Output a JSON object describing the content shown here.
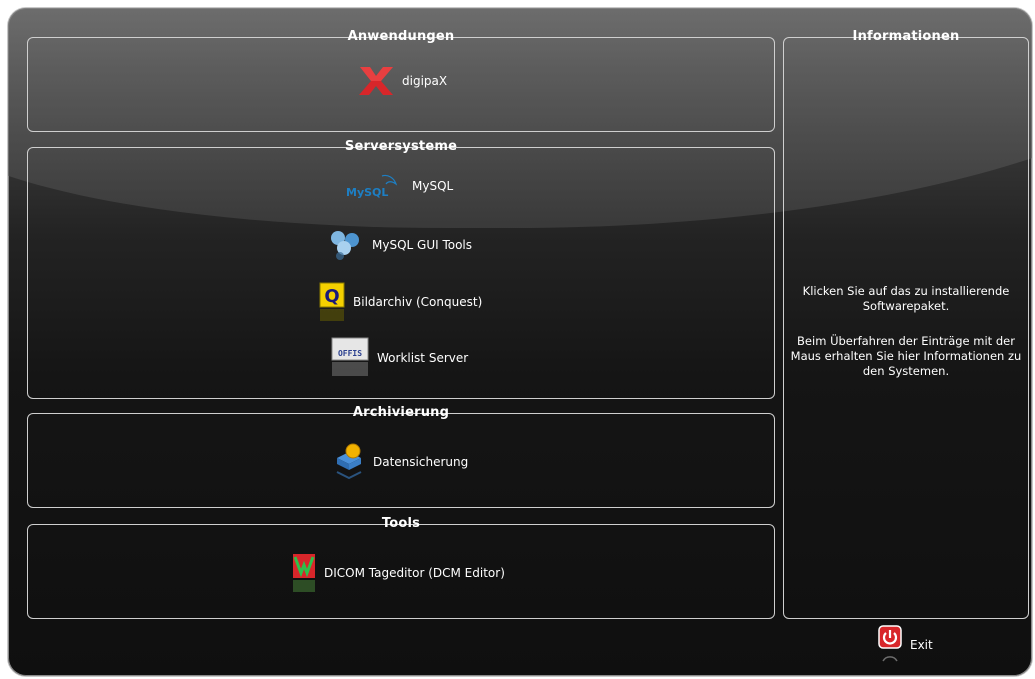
{
  "groups": {
    "anwendungen": {
      "title": "Anwendungen",
      "items": [
        {
          "label": "digipaX",
          "icon": "digipax-x-icon"
        }
      ]
    },
    "serversysteme": {
      "title": "Serversysteme",
      "items": [
        {
          "label": "MySQL",
          "icon": "mysql-logo-icon"
        },
        {
          "label": "MySQL GUI Tools",
          "icon": "mysql-gui-tools-icon"
        },
        {
          "label": "Bildarchiv (Conquest)",
          "icon": "conquest-q-icon"
        },
        {
          "label": "Worklist Server",
          "icon": "offis-icon"
        }
      ]
    },
    "archivierung": {
      "title": "Archivierung",
      "items": [
        {
          "label": "Datensicherung",
          "icon": "backup-icon"
        }
      ]
    },
    "tools": {
      "title": "Tools",
      "items": [
        {
          "label": "DICOM Tageditor (DCM Editor)",
          "icon": "dcm-editor-icon"
        }
      ]
    },
    "informationen": {
      "title": "Informationen",
      "line1": "Klicken Sie auf das zu installierende Softwarepaket.",
      "line2": "Beim Überfahren der Einträge mit der Maus erhalten Sie hier Informationen zu den Systemen."
    }
  },
  "logo_text": "MySQL",
  "offis_text": "OFFIS",
  "exit_label": "Exit",
  "colors": {
    "accent_red": "#d8262a",
    "mysql_blue": "#1d7fc4",
    "mysql_orange": "#f29111",
    "conquest_yellow": "#f4d000"
  }
}
